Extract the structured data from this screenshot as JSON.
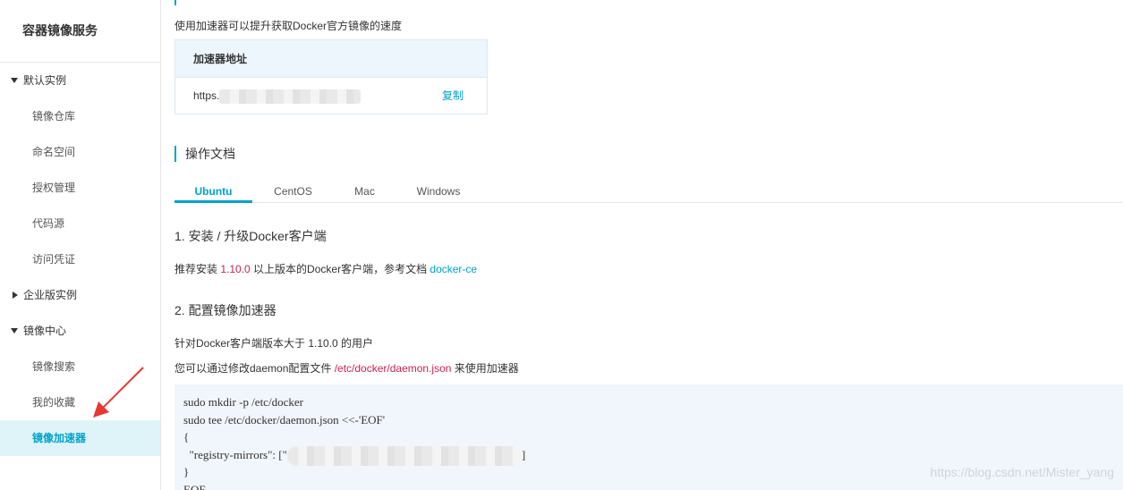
{
  "sidebar": {
    "title": "容器镜像服务",
    "groups": [
      {
        "label": "默认实例",
        "expanded": true,
        "items": [
          "镜像仓库",
          "命名空间",
          "授权管理",
          "代码源",
          "访问凭证"
        ]
      },
      {
        "label": "企业版实例",
        "expanded": false
      },
      {
        "label": "镜像中心",
        "expanded": true,
        "items": [
          "镜像搜索",
          "我的收藏",
          "镜像加速器"
        ]
      }
    ],
    "active_item": "镜像加速器"
  },
  "main": {
    "intro": "使用加速器可以提升获取Docker官方镜像的速度",
    "accelerator": {
      "header": "加速器地址",
      "url_prefix": "https.",
      "copy_label": "复制"
    },
    "doc_title": "操作文档",
    "tabs": [
      "Ubuntu",
      "CentOS",
      "Mac",
      "Windows"
    ],
    "active_tab": "Ubuntu",
    "step1": {
      "title": "1. 安装 / 升级Docker客户端",
      "text_before": "推荐安装 ",
      "version": "1.10.0",
      "text_after": " 以上版本的Docker客户端，参考文档 ",
      "link": "docker-ce"
    },
    "step2": {
      "title": "2. 配置镜像加速器",
      "line1": "针对Docker客户端版本大于 1.10.0 的用户",
      "line2_before": "您可以通过修改daemon配置文件 ",
      "line2_path": "/etc/docker/daemon.json",
      "line2_after": " 来使用加速器"
    },
    "code": {
      "line1": "sudo mkdir -p /etc/docker",
      "line2": "sudo tee /etc/docker/daemon.json <<-'EOF'",
      "line3": "{",
      "line4_prefix": "  \"registry-mirrors\": [\"",
      "line4_suffix": "]",
      "line5": "}",
      "line6": "EOF"
    }
  },
  "watermark": "https://blog.csdn.net/Mister_yang",
  "colors": {
    "accent": "#00a2ca",
    "highlight": "#c7254e",
    "active_bg": "#dff4f8",
    "code_bg": "#f1f6fc"
  }
}
